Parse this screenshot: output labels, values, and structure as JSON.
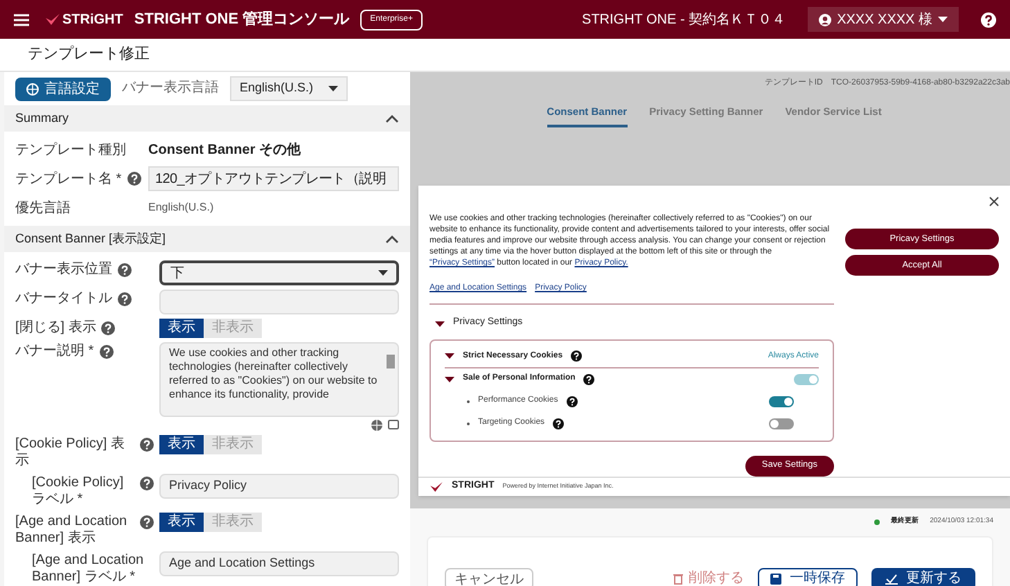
{
  "header": {
    "brand": "STRiGHT",
    "title": "STRIGHT ONE 管理コンソール",
    "plan_badge": "Enterprise+",
    "contract": "STRIGHT ONE - 契約名ＫＴ０４",
    "user": "XXXX XXXX 様"
  },
  "page_title": "テンプレート修正",
  "language": {
    "button": "言語設定",
    "label": "バナー表示言語",
    "value": "English(U.S.)"
  },
  "summary": {
    "title": "Summary",
    "expanded": true,
    "rows": [
      {
        "kind": "text",
        "label": "テンプレート種別",
        "value": "Consent Banner その他"
      },
      {
        "kind": "input",
        "label": "テンプレート名 *",
        "help": true,
        "value": "120_オプトアウトテンプレート（説明"
      },
      {
        "kind": "small",
        "label": "優先言語",
        "value": "English(U.S.)"
      }
    ]
  },
  "consent": {
    "title": "Consent Banner [表示設定]",
    "expanded": true,
    "rows": [
      {
        "kind": "select",
        "label": "バナー表示位置",
        "help": true,
        "value": "下"
      },
      {
        "kind": "input",
        "label": "バナータイトル",
        "help": true
      },
      {
        "kind": "toggle",
        "label": "[閉じる] 表示",
        "help": true,
        "options": [
          {
            "label": "表示",
            "selected": true
          },
          {
            "label": "非表示",
            "selected": false
          }
        ]
      },
      {
        "kind": "textarea",
        "label": "バナー説明 *",
        "help": true,
        "value": "We use cookies and other tracking technologies (hereinafter collectively referred to as \"Cookies\") on our website to enhance its functionality, provide"
      },
      {
        "kind": "toggle",
        "label": "[Cookie Policy] 表示",
        "help": true,
        "options": [
          {
            "label": "表示",
            "selected": true
          },
          {
            "label": "非表示",
            "selected": false
          }
        ]
      },
      {
        "kind": "input",
        "label": "[Cookie Policy] ラベル *",
        "help": true,
        "indent": true,
        "value": "Privacy Policy"
      },
      {
        "kind": "toggle",
        "label": "[Age and Location Banner] 表示",
        "help": true,
        "options": [
          {
            "label": "表示",
            "selected": true
          },
          {
            "label": "非表示",
            "selected": false
          }
        ]
      },
      {
        "kind": "input",
        "label": "[Age and Location Banner] ラベル *",
        "indent": true,
        "value": "Age and Location Settings"
      }
    ]
  },
  "preview": {
    "template_id_label": "テンプレートID",
    "template_id": "TCO-26037953-59b9-4168-ab80-b3292a22c3ab",
    "tabs": [
      {
        "label": "Consent Banner",
        "selected": true
      },
      {
        "label": "Privacy Setting Banner",
        "selected": false
      },
      {
        "label": "Vendor Service List",
        "selected": false
      }
    ],
    "banner": {
      "description": [
        {
          "kind": "text",
          "text": "We use cookies and other tracking technologies (hereinafter collectively referred to as \"Cookies\") on our website to enhance its functionality, provide content and advertisements tailored to your interests, offer social media features and improve our website through access analysis. You can change your consent or rejection settings at any time via the hover button displayed at the bottom left of this site or through the "
        },
        {
          "kind": "link",
          "text": "“Privacy Settings”"
        },
        {
          "kind": "text",
          "text": " button located in our "
        },
        {
          "kind": "link",
          "text": "Privacy Policy."
        }
      ],
      "links": [
        "Age and Location Settings",
        "Privacy Policy"
      ],
      "privacy_settings": {
        "title": "Privacy Settings",
        "expanded": true
      },
      "categories": [
        {
          "kind": "group",
          "name": "Strict Necessary Cookies",
          "status": "Always Active"
        },
        {
          "kind": "group",
          "name": "Sale of Personal Information",
          "on": true,
          "partial": true
        },
        {
          "kind": "item",
          "name": "Performance Cookies",
          "on": true
        },
        {
          "kind": "item",
          "name": "Targeting Cookies",
          "on": false
        }
      ],
      "save": "Save Settings",
      "buttons": [
        "Pricavy Settings",
        "Accept All"
      ],
      "footer_brand": "STRIGHT",
      "footer_text": "Powered by Internet Initiative Japan Inc."
    }
  },
  "status": {
    "label": "最終更新",
    "time": "2024/10/03 12:01:34"
  },
  "actions": {
    "cancel": "キャンセル",
    "delete": "削除する",
    "save": "一時保存",
    "update": "更新する"
  }
}
